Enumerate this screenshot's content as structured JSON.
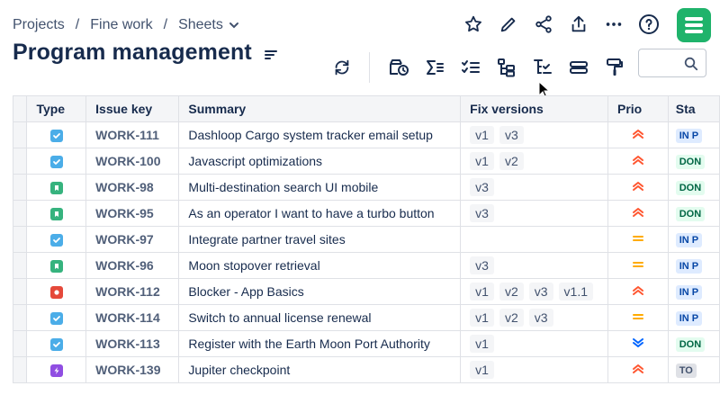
{
  "breadcrumb": {
    "projects": "Projects",
    "sep": "/",
    "space": "Fine work",
    "sheets": "Sheets"
  },
  "page": {
    "title": "Program management"
  },
  "search": {
    "placeholder": "",
    "value": ""
  },
  "table": {
    "columns": {
      "type": "Type",
      "key": "Issue key",
      "summary": "Summary",
      "fix": "Fix versions",
      "prio": "Prio",
      "status": "Sta"
    },
    "rows": [
      {
        "type": "task",
        "key": "WORK-111",
        "summary": "Dashloop Cargo system tracker email setup",
        "versions": [
          "v1",
          "v3"
        ],
        "prio": "high",
        "status": "IN P",
        "status_kind": "inprogress"
      },
      {
        "type": "task",
        "key": "WORK-100",
        "summary": "Javascript optimizations",
        "versions": [
          "v1",
          "v2"
        ],
        "prio": "high",
        "status": "DON",
        "status_kind": "done"
      },
      {
        "type": "story",
        "key": "WORK-98",
        "summary": "Multi-destination search UI mobile",
        "versions": [
          "v3"
        ],
        "prio": "high",
        "status": "DON",
        "status_kind": "done"
      },
      {
        "type": "story",
        "key": "WORK-95",
        "summary": "As an operator I want to have a turbo button",
        "versions": [
          "v3"
        ],
        "prio": "high",
        "status": "DON",
        "status_kind": "done"
      },
      {
        "type": "task",
        "key": "WORK-97",
        "summary": "Integrate partner travel sites",
        "versions": [],
        "prio": "medium",
        "status": "IN P",
        "status_kind": "inprogress"
      },
      {
        "type": "story",
        "key": "WORK-96",
        "summary": "Moon stopover retrieval",
        "versions": [
          "v3"
        ],
        "prio": "medium",
        "status": "IN P",
        "status_kind": "inprogress"
      },
      {
        "type": "bug",
        "key": "WORK-112",
        "summary": "Blocker - App Basics",
        "versions": [
          "v1",
          "v2",
          "v3",
          "v1.1"
        ],
        "prio": "high",
        "status": "IN P",
        "status_kind": "inprogress"
      },
      {
        "type": "task",
        "key": "WORK-114",
        "summary": "Switch to annual license renewal",
        "versions": [
          "v1",
          "v2",
          "v3"
        ],
        "prio": "medium",
        "status": "IN P",
        "status_kind": "inprogress"
      },
      {
        "type": "task",
        "key": "WORK-113",
        "summary": "Register with the Earth Moon Port Authority",
        "versions": [
          "v1"
        ],
        "prio": "lowest",
        "status": "DON",
        "status_kind": "done"
      },
      {
        "type": "epic",
        "key": "WORK-139",
        "summary": "Jupiter checkpoint",
        "versions": [
          "v1"
        ],
        "prio": "high",
        "status": "TO",
        "status_kind": "todo"
      }
    ]
  },
  "colors": {
    "task": "#4bade8",
    "story": "#36b37e",
    "bug": "#e5493a",
    "epic": "#904ee2",
    "prio_high": "#ff5630",
    "prio_medium": "#ffab00",
    "prio_lowest": "#0065ff",
    "logo": "#1fb36b"
  },
  "icons": {
    "top": [
      "star-icon",
      "edit-icon",
      "share-icon",
      "export-icon",
      "more-icon",
      "help-icon"
    ],
    "toolbar": [
      "refresh-icon",
      "calendar-filter-icon",
      "sum-icon",
      "checklist-icon",
      "hierarchy-icon",
      "tree-filter-icon",
      "group-rows-icon",
      "format-paint-icon"
    ]
  }
}
